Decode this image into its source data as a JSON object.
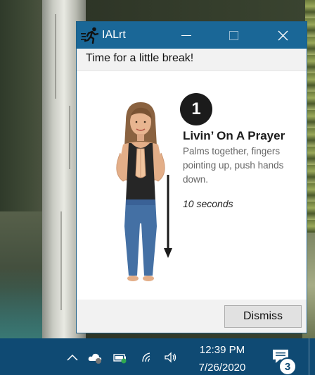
{
  "window": {
    "title": "IALrt",
    "header": "Time for a little break!"
  },
  "exercise": {
    "step": "1",
    "title": "Livin’ On A Prayer",
    "description": "Palms together, fingers pointing up, push hands down.",
    "duration": "10 seconds"
  },
  "footer": {
    "dismiss_label": "Dismiss"
  },
  "taskbar": {
    "time": "12:39 PM",
    "date": "7/26/2020",
    "notification_count": "3",
    "tray_icons": [
      "chevron-up-icon",
      "onedrive-icon",
      "battery-icon",
      "wifi-icon",
      "volume-icon",
      "action-center-icon"
    ]
  },
  "colors": {
    "titlebar": "#1a6797",
    "taskbar": "#0f4a73",
    "badge": "#1b1b1b"
  }
}
